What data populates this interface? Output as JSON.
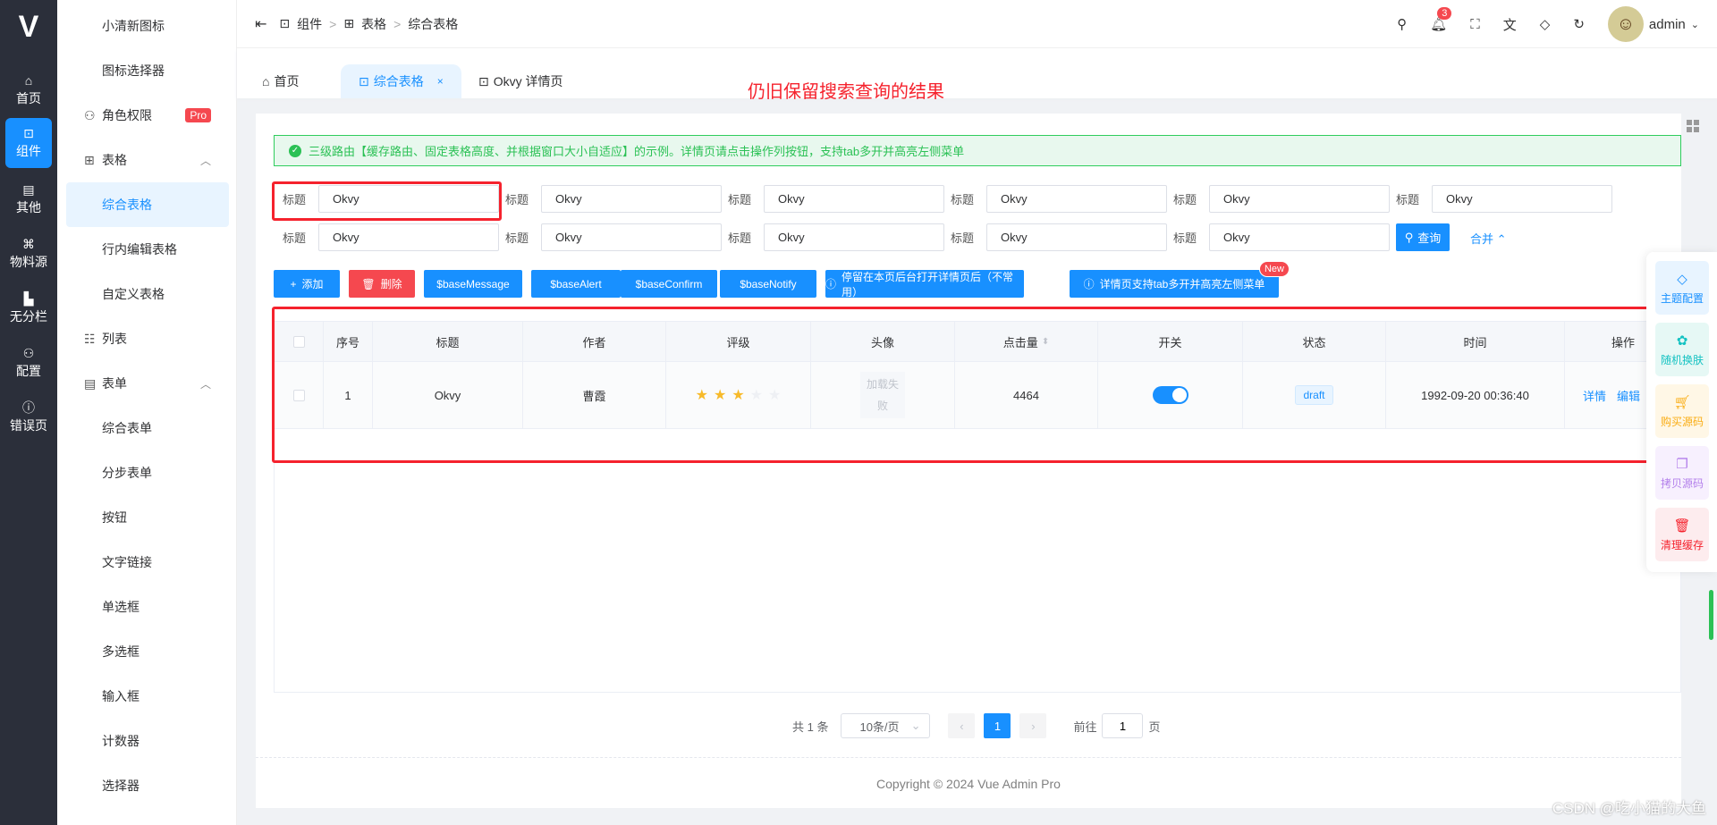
{
  "rail": [
    {
      "label": "首页",
      "icon": "home-icon"
    },
    {
      "label": "组件",
      "icon": "code-icon",
      "active": true
    },
    {
      "label": "其他",
      "icon": "archive-icon"
    },
    {
      "label": "物料源",
      "icon": "command-icon"
    },
    {
      "label": "无分栏",
      "icon": "chart-icon"
    },
    {
      "label": "配置",
      "icon": "user-cog-icon"
    },
    {
      "label": "错误页",
      "icon": "alert-icon"
    }
  ],
  "submenu": [
    {
      "label": "小清新图标"
    },
    {
      "label": "图标选择器"
    },
    {
      "label": "角色权限",
      "group": true,
      "badge": "Pro"
    },
    {
      "label": "表格",
      "group": true,
      "expanded": true
    },
    {
      "label": "综合表格",
      "active": true
    },
    {
      "label": "行内编辑表格"
    },
    {
      "label": "自定义表格"
    },
    {
      "label": "列表",
      "group": true
    },
    {
      "label": "表单",
      "group": true,
      "expanded": true
    },
    {
      "label": "综合表单"
    },
    {
      "label": "分步表单"
    },
    {
      "label": "按钮"
    },
    {
      "label": "文字链接"
    },
    {
      "label": "单选框"
    },
    {
      "label": "多选框"
    },
    {
      "label": "输入框"
    },
    {
      "label": "计数器"
    },
    {
      "label": "选择器"
    }
  ],
  "breadcrumb": [
    "组件",
    "表格",
    "综合表格"
  ],
  "header": {
    "notifications": "3",
    "user": "admin"
  },
  "tabs": [
    {
      "label": "首页"
    },
    {
      "label": "综合表格",
      "active": true
    },
    {
      "label": "Okvy 详情页"
    }
  ],
  "annotation": "仍旧保留搜索查询的结果",
  "alert": "三级路由【缓存路由、固定表格高度、并根据窗口大小自适应】的示例。详情页请点击操作列按钮，支持tab多开并高亮左侧菜单",
  "filters": {
    "label": "标题",
    "value": "Okvy",
    "count": 11,
    "search": "查询",
    "collapse": "合并"
  },
  "buttons": [
    {
      "label": "添加",
      "icon": "plus-icon"
    },
    {
      "label": "删除",
      "icon": "trash-icon",
      "danger": true
    },
    {
      "label": "$baseMessage"
    },
    {
      "label": "$baseAlert"
    },
    {
      "label": "$baseConfirm"
    },
    {
      "label": "$baseNotify"
    },
    {
      "label": "停留在本页后台打开详情页后（不常用）",
      "icon": "info-icon"
    },
    {
      "label": "详情页支持tab多开并高亮左侧菜单",
      "icon": "info-icon",
      "badge": "New"
    }
  ],
  "table": {
    "columns": [
      "",
      "序号",
      "标题",
      "作者",
      "评级",
      "头像",
      "点击量",
      "开关",
      "状态",
      "时间",
      "操作"
    ],
    "rows": [
      {
        "index": "1",
        "title": "Okvy",
        "author": "曹霞",
        "rating": 3,
        "rating_max": 5,
        "avatar": "加载失败",
        "clicks": "4464",
        "switch": true,
        "status": "draft",
        "time": "1992-09-20 00:36:40",
        "actions": [
          "详情",
          "编辑"
        ]
      }
    ]
  },
  "pagination": {
    "total": "共 1 条",
    "page_size": "10条/页",
    "current": "1",
    "goto": "前往",
    "goto_value": "1",
    "page_unit": "页"
  },
  "footer": "Copyright © 2024 Vue Admin Pro",
  "float_panel": [
    {
      "label": "主题配置",
      "color": "#1890ff",
      "bg": "#e8f4ff",
      "icon": "brush-icon"
    },
    {
      "label": "随机换肤",
      "color": "#13c2c2",
      "bg": "#e6f8f5",
      "icon": "palette-icon"
    },
    {
      "label": "购买源码",
      "color": "#faad14",
      "bg": "#fff7e6",
      "icon": "cart-icon"
    },
    {
      "label": "拷贝源码",
      "color": "#b37feb",
      "bg": "#f7f0fe",
      "icon": "copy-icon"
    },
    {
      "label": "清理缓存",
      "color": "#f5222d",
      "bg": "#fdecee",
      "icon": "trash-icon"
    }
  ],
  "watermark": "CSDN @吃小猫的大鱼"
}
